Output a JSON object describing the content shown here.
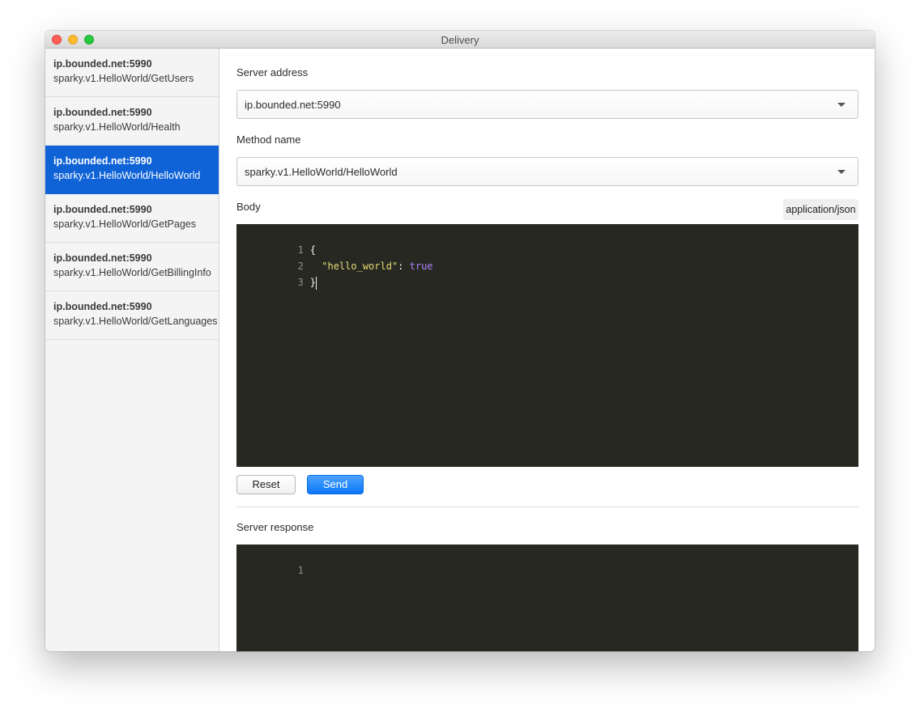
{
  "window": {
    "title": "Delivery"
  },
  "sidebar": {
    "items": [
      {
        "host": "ip.bounded.net:5990",
        "method": "sparky.v1.HelloWorld/GetUsers"
      },
      {
        "host": "ip.bounded.net:5990",
        "method": "sparky.v1.HelloWorld/Health"
      },
      {
        "host": "ip.bounded.net:5990",
        "method": "sparky.v1.HelloWorld/HelloWorld"
      },
      {
        "host": "ip.bounded.net:5990",
        "method": "sparky.v1.HelloWorld/GetPages"
      },
      {
        "host": "ip.bounded.net:5990",
        "method": "sparky.v1.HelloWorld/GetBillingInfo"
      },
      {
        "host": "ip.bounded.net:5990",
        "method": "sparky.v1.HelloWorld/GetLanguages"
      }
    ],
    "selected_index": 2
  },
  "form": {
    "server_address_label": "Server address",
    "server_address_value": "ip.bounded.net:5990",
    "method_name_label": "Method name",
    "method_name_value": "sparky.v1.HelloWorld/HelloWorld",
    "body_label": "Body",
    "content_type": "application/json",
    "body_lines": [
      {
        "num": "1",
        "open": "{"
      },
      {
        "num": "2",
        "key": "\"hello_world\"",
        "sep": ": ",
        "value": "true"
      },
      {
        "num": "3",
        "close": "}"
      }
    ],
    "reset_label": "Reset",
    "send_label": "Send"
  },
  "response": {
    "label": "Server response",
    "lines": [
      {
        "num": "1"
      }
    ]
  },
  "colors": {
    "selection": "#0f63d7",
    "editor_bg": "#272822",
    "json_string": "#e6db74",
    "json_keyword": "#ae81ff",
    "send_button": "#1a84fb"
  },
  "icons": [
    "close-traffic-light",
    "minimize-traffic-light",
    "maximize-traffic-light",
    "chevron-down-icon"
  ]
}
